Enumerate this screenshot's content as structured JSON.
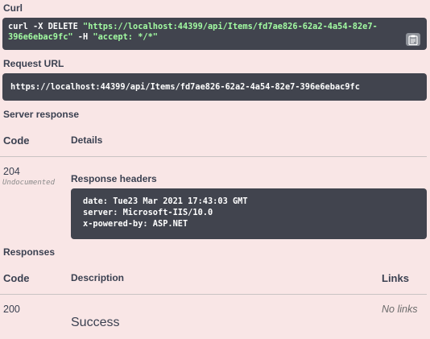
{
  "curl": {
    "label": "Curl",
    "cmd_prefix": "curl -X DELETE ",
    "url_part1": "\"https://localhost:44399/api/Items/fd7ae826-62a2-4a54-82e7-",
    "url_part2": "396e6ebac9fc\"",
    "flag": " -H  ",
    "header_value": "\"accept: */*\"",
    "copy_icon": "clipboard-icon"
  },
  "request_url": {
    "label": "Request URL",
    "value": "https://localhost:44399/api/Items/fd7ae826-62a2-4a54-82e7-396e6ebac9fc"
  },
  "server_response": {
    "label": "Server response",
    "col_code": "Code",
    "col_details": "Details",
    "code": "204",
    "undocumented": "Undocumented",
    "headers_title": "Response headers",
    "headers": [
      "date: Tue23 Mar 2021 17:43:03 GMT",
      "server: Microsoft-IIS/10.0",
      "x-powered-by: ASP.NET"
    ]
  },
  "responses": {
    "label": "Responses",
    "col_code": "Code",
    "col_description": "Description",
    "col_links": "Links",
    "rows": [
      {
        "code": "200",
        "description": "Success",
        "links": "No links"
      }
    ]
  }
}
